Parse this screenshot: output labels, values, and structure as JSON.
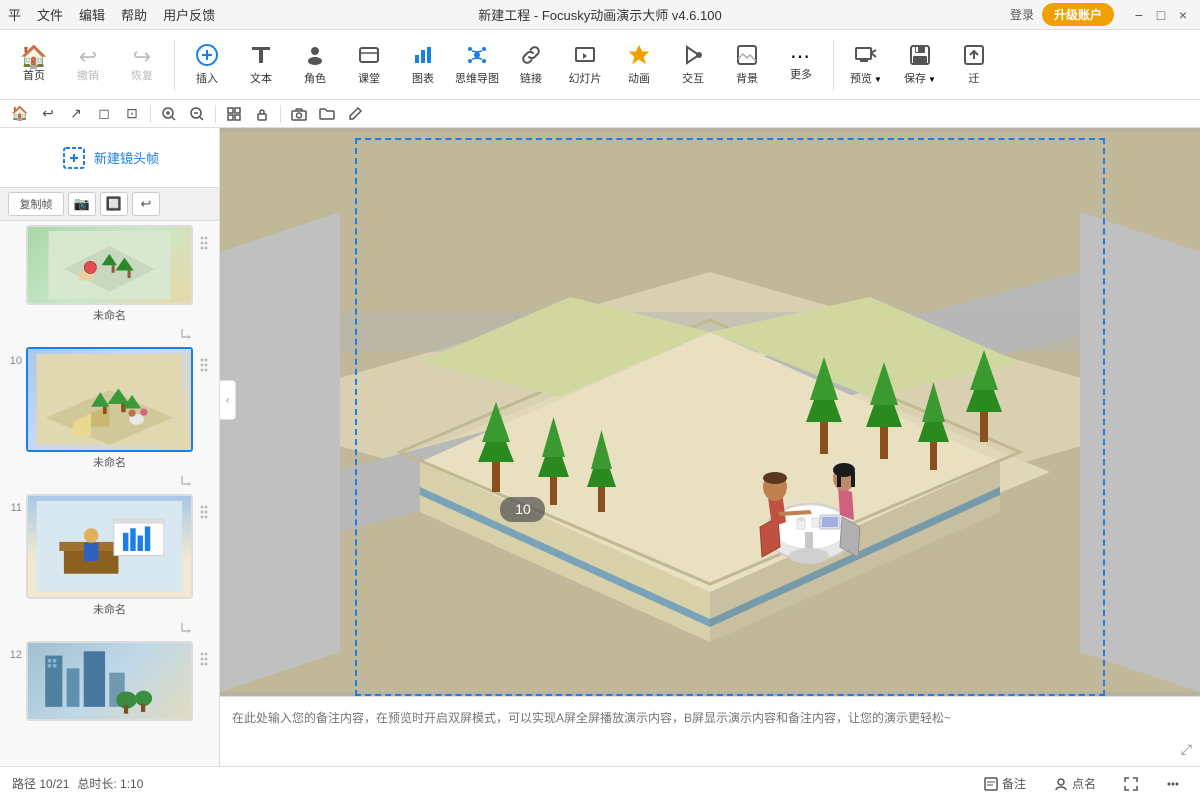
{
  "titlebar": {
    "menu": [
      "平",
      "文件",
      "编辑",
      "帮助",
      "用户反馈"
    ],
    "title": "新建工程 - Focusky动画演示大师  v4.6.100",
    "login": "登录",
    "upgrade": "升级账户",
    "win_min": "−",
    "win_max": "□",
    "win_close": "×"
  },
  "toolbar": {
    "items": [
      {
        "id": "home",
        "icon": "🏠",
        "label": "首页"
      },
      {
        "id": "undo",
        "icon": "↩",
        "label": "撤销"
      },
      {
        "id": "redo",
        "icon": "↪",
        "label": "恢复"
      },
      {
        "id": "insert",
        "icon": "➕",
        "label": "插入"
      },
      {
        "id": "text",
        "icon": "📝",
        "label": "文本"
      },
      {
        "id": "role",
        "icon": "👤",
        "label": "角色"
      },
      {
        "id": "class",
        "icon": "📚",
        "label": "课堂"
      },
      {
        "id": "chart",
        "icon": "📊",
        "label": "图表"
      },
      {
        "id": "mindmap",
        "icon": "🗺",
        "label": "思维导图"
      },
      {
        "id": "link",
        "icon": "🔗",
        "label": "链接"
      },
      {
        "id": "slides",
        "icon": "🖼",
        "label": "幻灯片"
      },
      {
        "id": "animation",
        "icon": "⭐",
        "label": "动画"
      },
      {
        "id": "interact",
        "icon": "🖱",
        "label": "交互"
      },
      {
        "id": "background",
        "icon": "🖼",
        "label": "背景"
      },
      {
        "id": "more",
        "icon": "⋯",
        "label": "更多"
      },
      {
        "id": "preview",
        "icon": "▶",
        "label": "预览"
      },
      {
        "id": "save",
        "icon": "💾",
        "label": "保存"
      },
      {
        "id": "export",
        "icon": "⬆",
        "label": "迁"
      }
    ]
  },
  "canvas_toolbar": {
    "buttons": [
      "🏠",
      "↩",
      "↗",
      "◻",
      "◻",
      "🔍+",
      "🔍-",
      "⊞",
      "🔒",
      "📷",
      "📁",
      "✏"
    ]
  },
  "sidebar": {
    "new_frame_label": "新建镜头帧",
    "toolbar_buttons": [
      "复制帧",
      "📷",
      "🔲",
      "↩"
    ],
    "slides": [
      {
        "number": "",
        "name": "未命名",
        "active": false
      },
      {
        "number": "10",
        "name": "未命名",
        "active": true
      },
      {
        "number": "11",
        "name": "未命名",
        "active": false
      },
      {
        "number": "12",
        "name": "",
        "active": false
      }
    ]
  },
  "canvas": {
    "slide_badge": "10",
    "scene_bg_color": "#e8dfc0"
  },
  "playback": {
    "current": "10",
    "total": "21",
    "label": "10/21"
  },
  "note": {
    "placeholder": "在此处输入您的备注内容，在预览时开启双屏模式，可以实现A屏全屏播放演示内容，B屏显示演示内容和备注内容，让您的演示更轻松~"
  },
  "statusbar": {
    "path": "路径 10/21",
    "duration": "总时长: 1:10",
    "note_btn": "备注",
    "mark_btn": "点名",
    "btn3": "⬛",
    "btn4": "⋯"
  }
}
